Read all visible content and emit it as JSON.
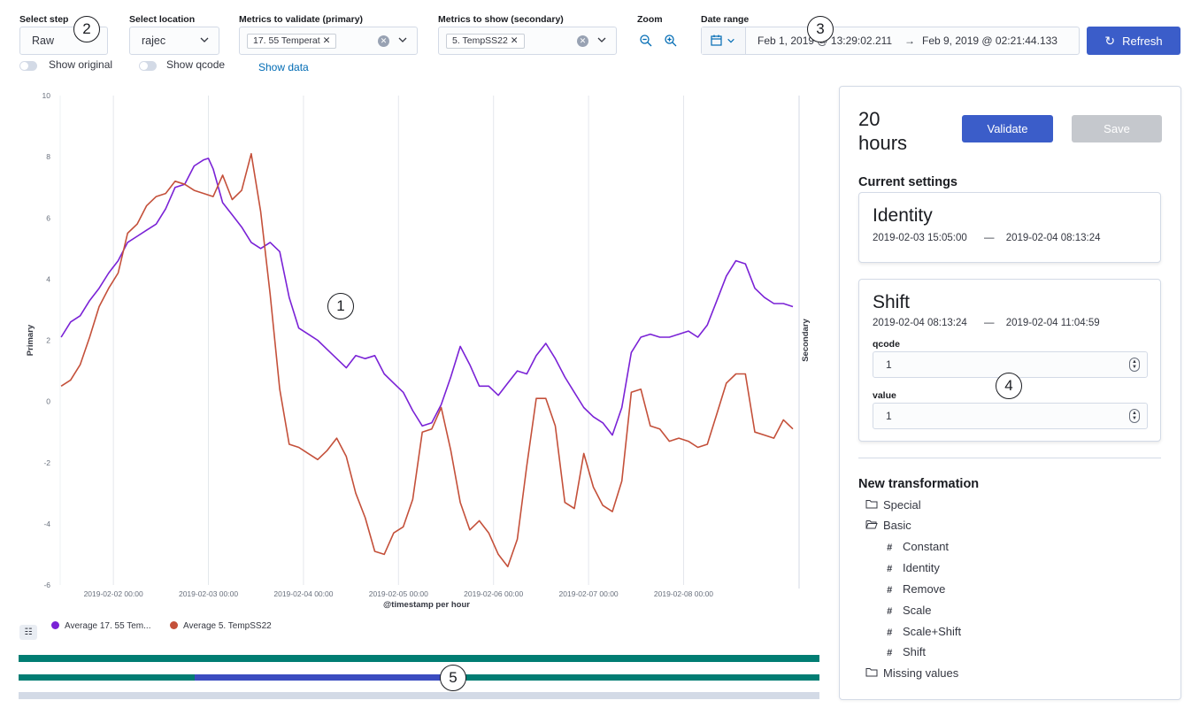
{
  "controls": {
    "select_step": {
      "label": "Select step",
      "value": "Raw"
    },
    "select_location": {
      "label": "Select location",
      "value": "rajec"
    },
    "primary_metrics": {
      "label": "Metrics to validate (primary)",
      "tag": "17. 55 Temperat"
    },
    "secondary_metrics": {
      "label": "Metrics to show (secondary)",
      "tag": "5. TempSS22"
    },
    "zoom": {
      "label": "Zoom"
    },
    "date_range": {
      "label": "Date range",
      "start": "Feb 1, 2019 @ 13:29:02.211",
      "arrow": "→",
      "end": "Feb 9, 2019 @ 02:21:44.133"
    },
    "refresh_label": "Refresh",
    "show_original": "Show original",
    "show_qcode": "Show qcode",
    "show_data": "Show data"
  },
  "callouts": [
    "1",
    "2",
    "3",
    "4",
    "5"
  ],
  "chart_data": {
    "type": "line",
    "xlabel": "@timestamp per hour",
    "ylabel": "Primary",
    "y2label": "Secondary",
    "ylim": [
      -6,
      10
    ],
    "yticks": [
      "10",
      "8",
      "6",
      "4",
      "2",
      "0",
      "-2",
      "-4",
      "-6"
    ],
    "xticks": [
      "2019-02-02 00:00",
      "2019-02-03 00:00",
      "2019-02-04 00:00",
      "2019-02-05 00:00",
      "2019-02-06 00:00",
      "2019-02-07 00:00",
      "2019-02-08 00:00"
    ],
    "xtick_days": [
      1,
      2,
      3,
      4,
      5,
      6,
      7
    ],
    "xlim_days": [
      0.44,
      8.15
    ],
    "grid": "vertical",
    "series": [
      {
        "name": "Average 17. 55 Tem...",
        "color": "#7a22d6",
        "x": [
          0.45,
          0.55,
          0.65,
          0.75,
          0.85,
          0.95,
          1.05,
          1.15,
          1.25,
          1.35,
          1.45,
          1.55,
          1.65,
          1.75,
          1.85,
          1.95,
          2.0,
          2.05,
          2.15,
          2.25,
          2.35,
          2.45,
          2.55,
          2.65,
          2.75,
          2.85,
          2.95,
          3.05,
          3.15,
          3.25,
          3.35,
          3.45,
          3.55,
          3.65,
          3.75,
          3.85,
          3.95,
          4.05,
          4.15,
          4.25,
          4.35,
          4.45,
          4.55,
          4.65,
          4.75,
          4.85,
          4.95,
          5.05,
          5.15,
          5.25,
          5.35,
          5.45,
          5.55,
          5.65,
          5.75,
          5.85,
          5.95,
          6.05,
          6.15,
          6.25,
          6.35,
          6.45,
          6.55,
          6.65,
          6.75,
          6.85,
          6.95,
          7.05,
          7.15,
          7.25,
          7.35,
          7.45,
          7.55,
          7.65,
          7.75,
          7.85,
          7.95,
          8.05,
          8.15
        ],
        "y": [
          2.1,
          2.6,
          2.8,
          3.3,
          3.7,
          4.2,
          4.6,
          5.2,
          5.4,
          5.6,
          5.8,
          6.3,
          7.0,
          7.1,
          7.7,
          7.9,
          7.95,
          7.6,
          6.5,
          6.1,
          5.7,
          5.2,
          5.0,
          5.2,
          4.9,
          3.4,
          2.4,
          2.2,
          2.0,
          1.7,
          1.4,
          1.1,
          1.5,
          1.4,
          1.5,
          0.9,
          0.6,
          0.3,
          -0.3,
          -0.8,
          -0.7,
          -0.1,
          0.8,
          1.8,
          1.2,
          0.5,
          0.5,
          0.2,
          0.6,
          1.0,
          0.9,
          1.5,
          1.9,
          1.4,
          0.8,
          0.3,
          -0.2,
          -0.5,
          -0.7,
          -1.1,
          -0.2,
          1.6,
          2.1,
          2.2,
          2.1,
          2.1,
          2.2,
          2.3,
          2.1,
          2.5,
          3.3,
          4.1,
          4.6,
          4.5,
          3.7,
          3.4,
          3.2,
          3.2,
          3.1
        ]
      },
      {
        "name": "Average 5. TempSS22",
        "color": "#c4503a",
        "x": [
          0.45,
          0.55,
          0.65,
          0.75,
          0.85,
          0.95,
          1.05,
          1.15,
          1.25,
          1.35,
          1.45,
          1.55,
          1.65,
          1.75,
          1.85,
          1.95,
          2.05,
          2.15,
          2.25,
          2.35,
          2.45,
          2.55,
          2.65,
          2.75,
          2.85,
          2.95,
          3.05,
          3.15,
          3.25,
          3.35,
          3.45,
          3.55,
          3.65,
          3.75,
          3.85,
          3.95,
          4.05,
          4.15,
          4.25,
          4.35,
          4.45,
          4.55,
          4.65,
          4.75,
          4.85,
          4.95,
          5.05,
          5.15,
          5.25,
          5.35,
          5.45,
          5.55,
          5.65,
          5.75,
          5.85,
          5.95,
          6.05,
          6.15,
          6.25,
          6.35,
          6.45,
          6.55,
          6.65,
          6.75,
          6.85,
          6.95,
          7.05,
          7.15,
          7.25,
          7.35,
          7.45,
          7.55,
          7.65,
          7.75,
          7.85,
          7.95,
          8.05,
          8.15
        ],
        "y": [
          0.5,
          0.7,
          1.2,
          2.1,
          3.1,
          3.7,
          4.2,
          5.5,
          5.8,
          6.4,
          6.7,
          6.8,
          7.2,
          7.1,
          6.9,
          6.8,
          6.7,
          7.4,
          6.6,
          6.9,
          8.1,
          6.2,
          3.5,
          0.4,
          -1.4,
          -1.5,
          -1.7,
          -1.9,
          -1.6,
          -1.2,
          -1.8,
          -3.0,
          -3.8,
          -4.9,
          -5.0,
          -4.3,
          -4.1,
          -3.2,
          -1.0,
          -0.9,
          -0.2,
          -1.6,
          -3.3,
          -4.2,
          -3.9,
          -4.3,
          -5.0,
          -5.4,
          -4.5,
          -2.1,
          0.1,
          0.1,
          -0.8,
          -3.3,
          -3.5,
          -1.7,
          -2.8,
          -3.4,
          -3.6,
          -2.6,
          0.3,
          0.4,
          -0.8,
          -0.9,
          -1.3,
          -1.2,
          -1.3,
          -1.5,
          -1.4,
          -0.4,
          0.6,
          0.9,
          0.9,
          -1.0,
          -1.1,
          -1.2,
          -0.6,
          -0.9
        ]
      }
    ]
  },
  "legend": [
    {
      "label": "Average 17. 55 Tem...",
      "color": "#7a22d6"
    },
    {
      "label": "Average 5. TempSS22",
      "color": "#c4503a"
    }
  ],
  "panel": {
    "duration_value": "20",
    "duration_unit": "hours",
    "validate_label": "Validate",
    "save_label": "Save",
    "current_settings_title": "Current settings",
    "identity": {
      "title": "Identity",
      "start": "2019-02-03 15:05:00",
      "dash": "—",
      "end": "2019-02-04 08:13:24"
    },
    "shift": {
      "title": "Shift",
      "start": "2019-02-04 08:13:24",
      "dash": "—",
      "end": "2019-02-04 11:04:59",
      "qcode_label": "qcode",
      "qcode_value": "1",
      "value_label": "value",
      "value_value": "1"
    },
    "new_transformation_title": "New transformation",
    "tree": {
      "special": "Special",
      "basic": "Basic",
      "basic_items": [
        "Constant",
        "Identity",
        "Remove",
        "Scale",
        "Scale+Shift",
        "Shift"
      ],
      "missing_values": "Missing values"
    }
  },
  "timeline": {
    "bar_color": "#017d73",
    "highlight_color": "#3b4cc0",
    "track_color": "#d3dae6",
    "highlight_fraction": [
      0.22,
      0.53
    ]
  }
}
